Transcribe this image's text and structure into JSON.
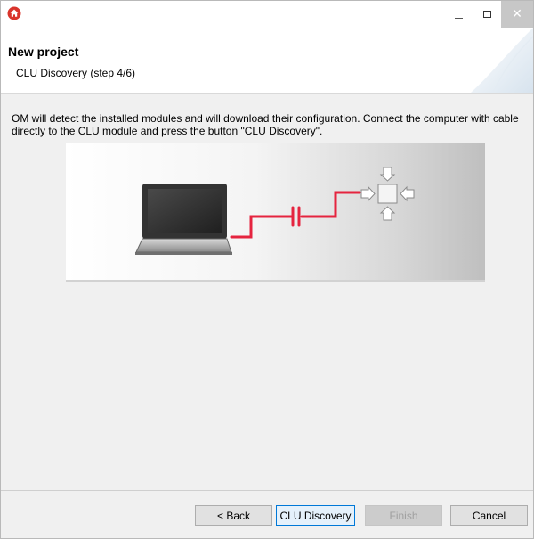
{
  "window": {
    "app_icon": "home-icon",
    "controls": {
      "minimize": "minimize-icon",
      "maximize": "maximize-icon",
      "close": "close-icon"
    }
  },
  "header": {
    "title": "New project",
    "subtitle": "CLU Discovery (step 4/6)"
  },
  "content": {
    "instruction": "OM will detect the installed modules and will download their configuration. Connect the computer with cable directly to the CLU module and press the button \"CLU Discovery\".",
    "illustration_icons": [
      "laptop-icon",
      "cable-icon",
      "clu-module-icon"
    ]
  },
  "footer": {
    "back_label": "< Back",
    "discovery_label": "CLU Discovery",
    "finish_label": "Finish",
    "cancel_label": "Cancel"
  },
  "colors": {
    "cable": "#e5243f",
    "app_icon": "#d9342b",
    "close_button": "#c7c7c7",
    "focus_border": "#0078d7"
  }
}
